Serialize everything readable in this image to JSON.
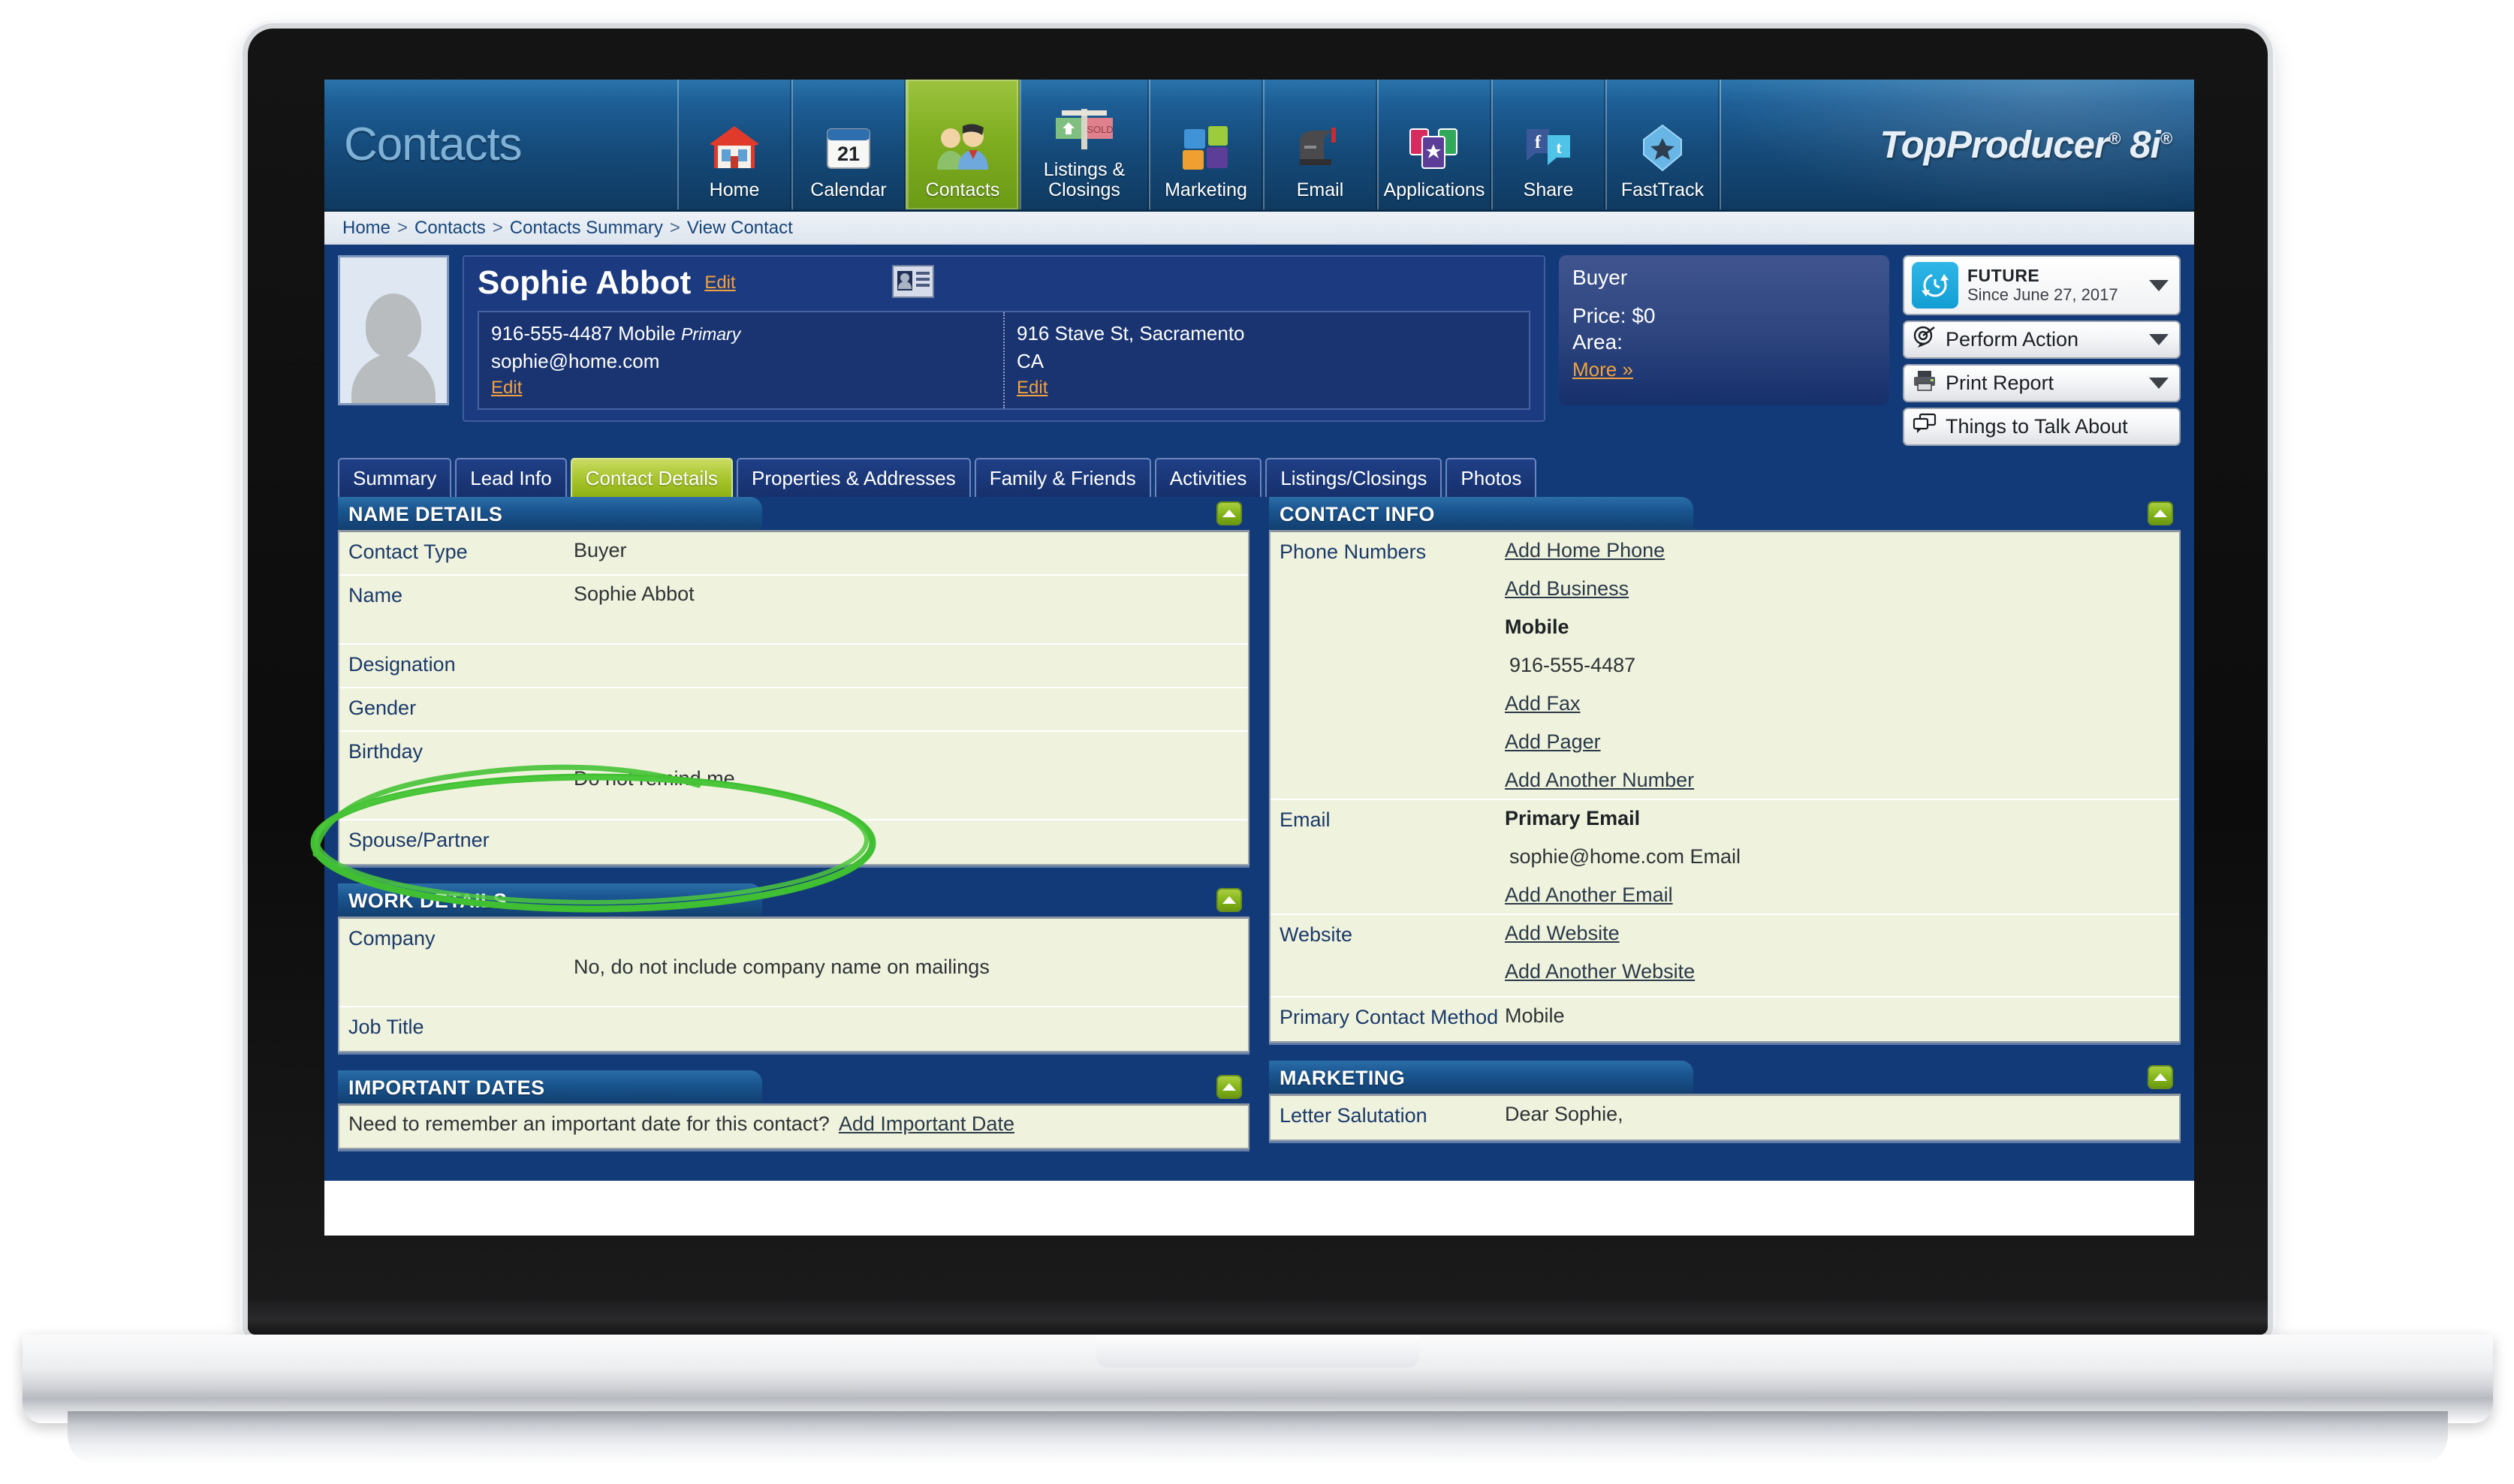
{
  "app": {
    "title": "Contacts",
    "brand": "TopProducer",
    "brand_reg1": "®",
    "brand_model": "8i",
    "brand_reg2": "®"
  },
  "nav": [
    {
      "label": "Home",
      "icon": "house-icon",
      "active": false
    },
    {
      "label": "Calendar",
      "icon": "calendar-icon",
      "active": false
    },
    {
      "label": "Contacts",
      "icon": "people-icon",
      "active": true
    },
    {
      "label": "Listings & Closings",
      "icon": "sold-sign-icon",
      "active": false
    },
    {
      "label": "Marketing",
      "icon": "puzzle-icon",
      "active": false
    },
    {
      "label": "Email",
      "icon": "mailbox-icon",
      "active": false
    },
    {
      "label": "Applications",
      "icon": "cards-star-icon",
      "active": false
    },
    {
      "label": "Share",
      "icon": "social-icon",
      "active": false
    },
    {
      "label": "FastTrack",
      "icon": "shield-star-icon",
      "active": false
    }
  ],
  "breadcrumb": {
    "items": [
      "Home",
      "Contacts",
      "Contacts Summary",
      "View Contact"
    ],
    "separator": ">"
  },
  "contact_header": {
    "name": "Sophie Abbot",
    "edit_label": "Edit",
    "vcard_icon": "vcard-icon",
    "phone_line": "916-555-4487 Mobile",
    "phone_primary_tag": "Primary",
    "email_line": "sophie@home.com",
    "left_edit": "Edit",
    "address_line1": "916 Stave St, Sacramento",
    "address_line2": "CA",
    "right_edit": "Edit"
  },
  "buyer_card": {
    "title": "Buyer",
    "price": "Price: $0",
    "area": "Area:",
    "more": "More »"
  },
  "actions": {
    "future": {
      "title": "FUTURE",
      "subtitle": "Since June 27, 2017",
      "icon": "clock-refresh-icon"
    },
    "perform_action": {
      "label": "Perform Action",
      "icon": "target-bubble-icon"
    },
    "print_report": {
      "label": "Print Report",
      "icon": "printer-icon"
    },
    "things_to_talk": {
      "label": "Things to Talk About",
      "icon": "chat-bubbles-icon"
    }
  },
  "tabs": [
    {
      "label": "Summary",
      "active": false
    },
    {
      "label": "Lead Info",
      "active": false
    },
    {
      "label": "Contact Details",
      "active": true
    },
    {
      "label": "Properties & Addresses",
      "active": false
    },
    {
      "label": "Family & Friends",
      "active": false
    },
    {
      "label": "Activities",
      "active": false
    },
    {
      "label": "Listings/Closings",
      "active": false
    },
    {
      "label": "Photos",
      "active": false
    }
  ],
  "panels": {
    "name_details": {
      "title": "NAME DETAILS",
      "rows": [
        {
          "label": "Contact Type",
          "value": "Buyer"
        },
        {
          "label": "Name",
          "value": "Sophie Abbot"
        },
        {
          "label": "Designation",
          "value": ""
        },
        {
          "label": "Gender",
          "value": ""
        },
        {
          "label": "Birthday",
          "value": "Do not remind me"
        },
        {
          "label": "Spouse/Partner",
          "value": ""
        }
      ]
    },
    "work_details": {
      "title": "WORK DETAILS",
      "rows": [
        {
          "label": "Company",
          "value": "No, do not include company name on mailings"
        },
        {
          "label": "Job Title",
          "value": ""
        }
      ]
    },
    "important_dates": {
      "title": "IMPORTANT DATES",
      "prompt": "Need to remember an important date for this contact?",
      "link": "Add Important Date"
    },
    "contact_info": {
      "title": "CONTACT INFO",
      "phone_label": "Phone Numbers",
      "phone_items": [
        {
          "text": "Add Home Phone",
          "kind": "link"
        },
        {
          "text": "Add Business",
          "kind": "link"
        },
        {
          "text": "Mobile",
          "kind": "bold"
        },
        {
          "text": "916-555-4487",
          "kind": "value"
        },
        {
          "text": "Add Fax",
          "kind": "link"
        },
        {
          "text": "Add Pager",
          "kind": "link"
        },
        {
          "text": "Add Another Number",
          "kind": "link"
        }
      ],
      "email_label": "Email",
      "email_items": [
        {
          "text": "Primary Email",
          "kind": "bold"
        },
        {
          "text": "sophie@home.com Email",
          "kind": "value"
        },
        {
          "text": "Add Another Email",
          "kind": "link"
        }
      ],
      "website_label": "Website",
      "website_items": [
        {
          "text": "Add Website",
          "kind": "link"
        },
        {
          "text": "Add Another Website",
          "kind": "link"
        }
      ],
      "primary_method_label": "Primary Contact Method",
      "primary_method_value": "Mobile"
    },
    "marketing": {
      "title": "MARKETING",
      "rows": [
        {
          "label": "Letter Salutation",
          "value": "Dear Sophie,"
        }
      ]
    }
  },
  "annotation": {
    "shape": "green-ellipse-highlight",
    "target": "Birthday",
    "color": "#3fbf31"
  }
}
